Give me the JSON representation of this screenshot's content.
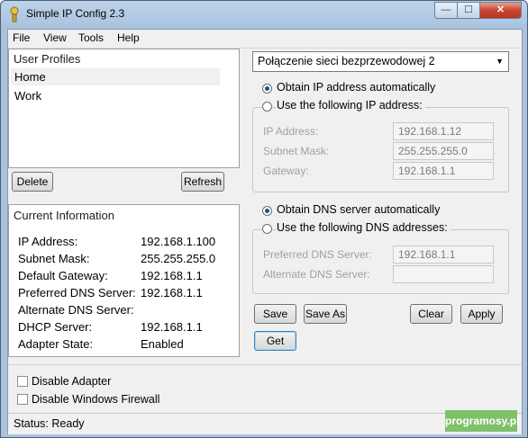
{
  "window": {
    "title": "Simple IP Config 2.3",
    "minimize": "—",
    "maximize": "☐",
    "close": "✕"
  },
  "menu": {
    "file": "File",
    "view": "View",
    "tools": "Tools",
    "help": "Help"
  },
  "profiles": {
    "heading": "User Profiles",
    "items": [
      "Home",
      "Work"
    ],
    "delete_label": "Delete",
    "refresh_label": "Refresh"
  },
  "current_info": {
    "heading": "Current Information",
    "rows": [
      {
        "label": "IP Address:",
        "value": "192.168.1.100"
      },
      {
        "label": "Subnet Mask:",
        "value": "255.255.255.0"
      },
      {
        "label": "Default Gateway:",
        "value": "192.168.1.1"
      },
      {
        "label": "Preferred DNS Server:",
        "value": "192.168.1.1"
      },
      {
        "label": "Alternate DNS Server:",
        "value": ""
      },
      {
        "label": "DHCP Server:",
        "value": "192.168.1.1"
      },
      {
        "label": "Adapter State:",
        "value": "Enabled"
      }
    ]
  },
  "adapter": {
    "selected": "Połączenie sieci bezprzewodowej 2"
  },
  "ip": {
    "auto_label": "Obtain IP address automatically",
    "manual_label": "Use the following IP address:",
    "ip_label": "IP Address:",
    "ip_value": "192.168.1.12",
    "subnet_label": "Subnet Mask:",
    "subnet_value": "255.255.255.0",
    "gateway_label": "Gateway:",
    "gateway_value": "192.168.1.1"
  },
  "dns": {
    "auto_label": "Obtain DNS server automatically",
    "manual_label": "Use the following DNS addresses:",
    "pref_label": "Preferred DNS Server:",
    "pref_value": "192.168.1.1",
    "alt_label": "Alternate DNS Server:",
    "alt_value": ""
  },
  "actions": {
    "save": "Save",
    "save_as": "Save As",
    "clear": "Clear",
    "apply": "Apply",
    "get": "Get"
  },
  "options": {
    "disable_adapter": "Disable Adapter",
    "disable_firewall": "Disable Windows Firewall"
  },
  "status": {
    "text": "Status: Ready"
  },
  "watermark": "programosy.pl"
}
